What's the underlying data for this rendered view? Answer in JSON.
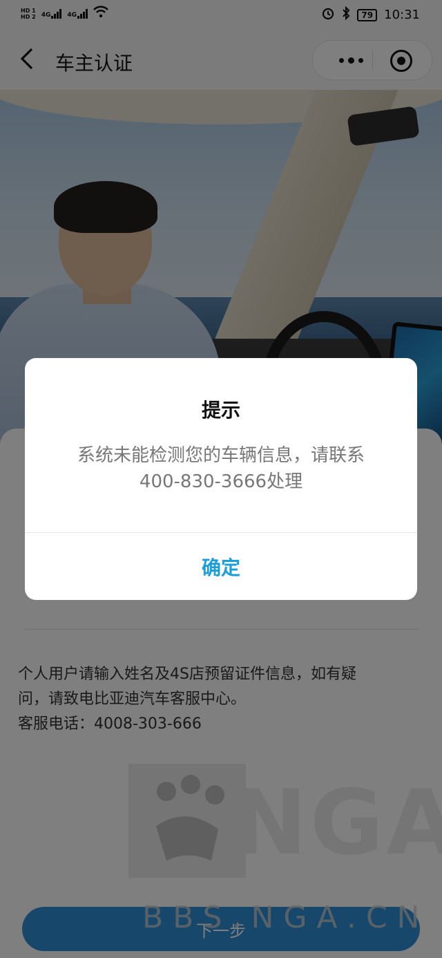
{
  "status_bar": {
    "sim1": "HD 1",
    "sim2": "HD 2",
    "net1": "4G",
    "net2": "4G",
    "battery": "79",
    "time": "10:31"
  },
  "title_bar": {
    "back_icon": "chevron-left-icon",
    "title": "车主认证",
    "more_icon": "more-dots-icon",
    "close_icon": "target-circle-icon"
  },
  "main": {
    "info_line1": "个人用户请输入姓名及4S店预留证件信息，如有疑",
    "info_line2": "问，请致电比亚迪汽车客服中心。",
    "info_line3": "客服电话：4008-303-666",
    "next_label": "下一步",
    "accent_color": "#2f8fd6"
  },
  "watermark": {
    "logo_text": "NGA",
    "url": "BBS.NGA.CN"
  },
  "dialog": {
    "title": "提示",
    "message_line1": "系统未能检测您的车辆信息，请联系",
    "message_line2": "400-830-3666处理",
    "ok_label": "确定",
    "ok_color": "#1e9ed8"
  }
}
